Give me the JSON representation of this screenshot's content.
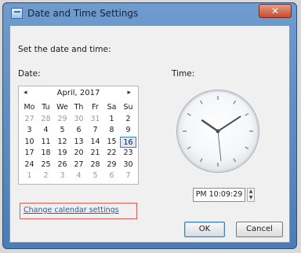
{
  "window": {
    "title": "Date and Time Settings",
    "close_label": "✕"
  },
  "content": {
    "heading": "Set the date and time:",
    "date_label": "Date:",
    "time_label": "Time:"
  },
  "calendar": {
    "prev": "◂",
    "next": "▸",
    "month_year": "April, 2017",
    "weekdays": [
      "Mo",
      "Tu",
      "We",
      "Th",
      "Fr",
      "Sa",
      "Su"
    ],
    "weeks": [
      [
        "27",
        "28",
        "29",
        "30",
        "31",
        "1",
        "2"
      ],
      [
        "3",
        "4",
        "5",
        "6",
        "7",
        "8",
        "9"
      ],
      [
        "10",
        "11",
        "12",
        "13",
        "14",
        "15",
        "16"
      ],
      [
        "17",
        "18",
        "19",
        "20",
        "21",
        "22",
        "23"
      ],
      [
        "24",
        "25",
        "26",
        "27",
        "28",
        "29",
        "30"
      ],
      [
        "1",
        "2",
        "3",
        "4",
        "5",
        "6",
        "7"
      ]
    ],
    "selected": "16"
  },
  "time": {
    "value": "PM 10:09:29",
    "spin_up": "▲",
    "spin_down": "▼"
  },
  "link": {
    "change_calendar": "Change calendar settings"
  },
  "buttons": {
    "ok": "OK",
    "cancel": "Cancel"
  },
  "colors": {
    "link": "#1f5fb3",
    "highlight": "#e05a5a",
    "accent": "#3c7fc4"
  }
}
